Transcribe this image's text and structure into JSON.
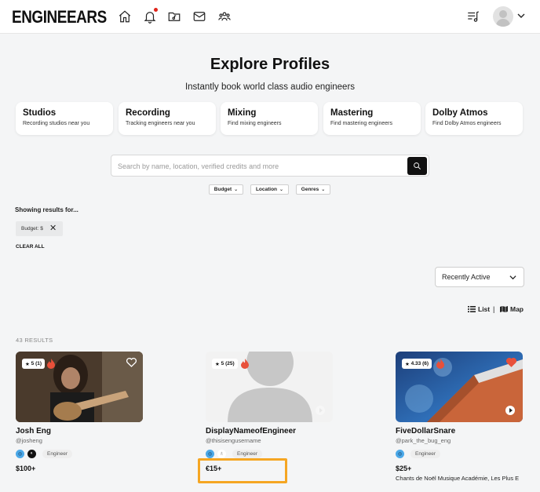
{
  "header": {
    "logo": "ENGINEEARS",
    "nav_icons": [
      "home-icon",
      "bell-icon",
      "folder-music-icon",
      "mail-icon",
      "community-icon"
    ],
    "right_icons": [
      "playlist-icon",
      "avatar",
      "chevron-down-icon"
    ],
    "notification_dot_color": "#e0251b"
  },
  "hero": {
    "title": "Explore Profiles",
    "subtitle": "Instantly book world class audio engineers"
  },
  "categories": [
    {
      "title": "Studios",
      "subtitle": "Recording studios near you"
    },
    {
      "title": "Recording",
      "subtitle": "Tracking engineers near you"
    },
    {
      "title": "Mixing",
      "subtitle": "Find mixing engineers"
    },
    {
      "title": "Mastering",
      "subtitle": "Find mastering engineers"
    },
    {
      "title": "Dolby Atmos",
      "subtitle": "Find Dolby Atmos engineers"
    }
  ],
  "search": {
    "placeholder": "Search by name, location, verified credits and more",
    "value": ""
  },
  "filters": [
    "Budget",
    "Location",
    "Genres"
  ],
  "results_filter": {
    "heading": "Showing results for...",
    "chips": [
      "Budget: $"
    ],
    "clear_all": "CLEAR ALL"
  },
  "sort": {
    "selected": "Recently Active"
  },
  "view": {
    "list_label": "List",
    "map_label": "Map",
    "separator": "|"
  },
  "results": {
    "count_label": "43 RESULTS",
    "cards": [
      {
        "name": "Josh Eng",
        "username": "@josheng",
        "rating": "5",
        "reviews": "(1)",
        "role": "Engineer",
        "price": "$100+",
        "credits": "",
        "favorited": false
      },
      {
        "name": "DisplayNameofEngineer",
        "username": "@thisisengusername",
        "rating": "5",
        "reviews": "(25)",
        "role": "Engineer",
        "price": "€15+",
        "credits": "",
        "favorited": false
      },
      {
        "name": "FiveDollarSnare",
        "username": "@park_the_bug_eng",
        "rating": "4.33",
        "reviews": "(6)",
        "role": "Engineer",
        "price": "$25+",
        "credits": "Chants de Noël Musique Académie, Les Plus E",
        "favorited": true
      }
    ]
  },
  "colors": {
    "accent_red": "#e8503a",
    "highlight_orange": "#f5a623",
    "background": "#f4f5f6"
  }
}
